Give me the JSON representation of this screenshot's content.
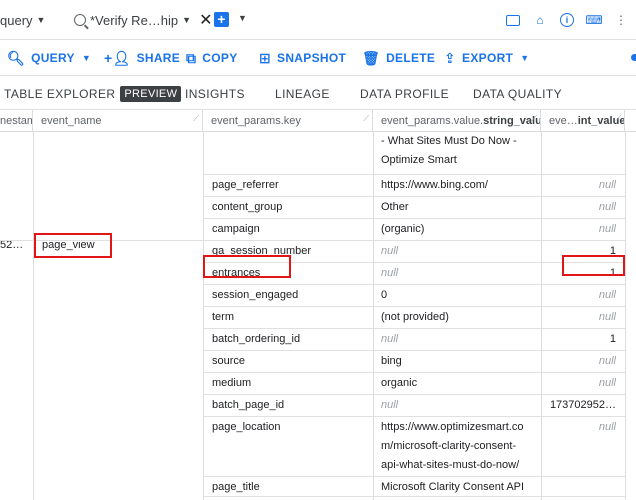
{
  "tabs": [
    {
      "label": "query",
      "has_menu": true,
      "closable": false
    },
    {
      "label": "*Verify Re…hip",
      "has_menu": true,
      "closable": true
    }
  ],
  "top_icons": [
    "cast-icon",
    "home-icon",
    "info-icon",
    "keyboard-icon",
    "more-vert-icon"
  ],
  "toolbar": {
    "query": "QUERY",
    "share": "SHARE",
    "copy": "COPY",
    "snapshot": "SNAPSHOT",
    "delete": "DELETE",
    "export": "EXPORT"
  },
  "subtabs": {
    "table_explorer": "TABLE EXPLORER",
    "preview_badge": "PREVIEW",
    "insights": "INSIGHTS",
    "lineage": "LINEAGE",
    "data_profile": "DATA PROFILE",
    "data_quality": "DATA QUALITY"
  },
  "table": {
    "columns": [
      "nestamp",
      "event_name",
      "event_params.key",
      "event_params.value.string_value",
      "eve…int_value"
    ],
    "col4_prefix": "event_params.value.",
    "col4_bold": "string_value",
    "col5_prefix": "eve…",
    "col5_bold": "int_value",
    "timestamp_fragment": "52…",
    "event_name": "page_view",
    "continued_value": [
      "- What Sites Must Do Now -",
      "Optimize Smart"
    ],
    "rows": [
      {
        "key": "page_referrer",
        "string_value": "https://www.bing.com/",
        "int_value": "null"
      },
      {
        "key": "content_group",
        "string_value": "Other",
        "int_value": "null"
      },
      {
        "key": "campaign",
        "string_value": "(organic)",
        "int_value": "null"
      },
      {
        "key": "ga_session_number",
        "string_value": "null",
        "int_value": "1"
      },
      {
        "key": "entrances",
        "string_value": "null",
        "int_value": "1"
      },
      {
        "key": "session_engaged",
        "string_value": "0",
        "int_value": "null"
      },
      {
        "key": "term",
        "string_value": "(not provided)",
        "int_value": "null"
      },
      {
        "key": "batch_ordering_id",
        "string_value": "null",
        "int_value": "1"
      },
      {
        "key": "source",
        "string_value": "bing",
        "int_value": "null"
      },
      {
        "key": "medium",
        "string_value": "organic",
        "int_value": "null"
      },
      {
        "key": "batch_page_id",
        "string_value": "null",
        "int_value": "173702952…"
      },
      {
        "key": "page_location",
        "string_value": [
          "https://www.optimizesmart.co",
          "m/microsoft-clarity-consent-",
          "api-what-sites-must-do-now/"
        ],
        "int_value": "null"
      },
      {
        "key": "page_title",
        "string_value": [
          "Microsoft Clarity Consent API",
          "- What Sites Must Do Now -"
        ],
        "int_value": ""
      }
    ]
  }
}
